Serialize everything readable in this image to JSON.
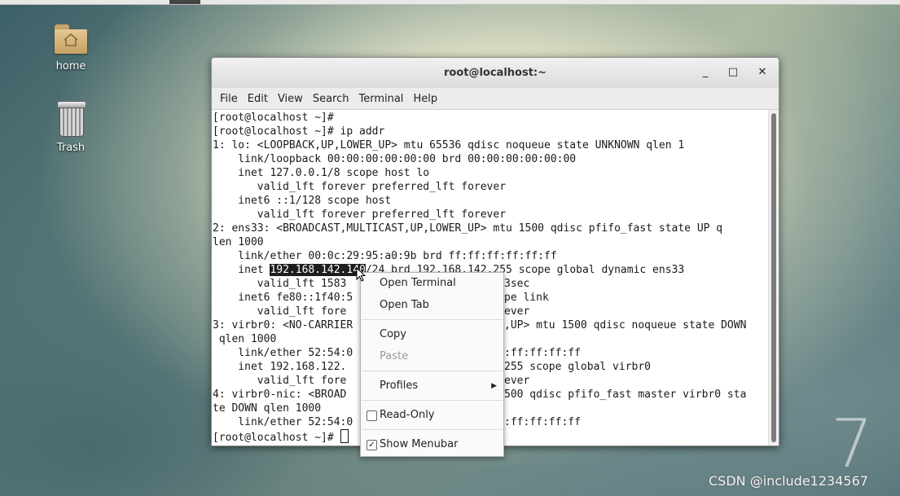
{
  "desktop": {
    "icons": [
      {
        "label": "home",
        "icon": "home-folder-icon"
      },
      {
        "label": "Trash",
        "icon": "trash-icon"
      }
    ],
    "brand_mark": "7",
    "watermark": "CSDN @include1234567"
  },
  "window": {
    "title": "root@localhost:~",
    "controls": {
      "minimize": "_",
      "maximize": "□",
      "close": "✕"
    },
    "menu": [
      "File",
      "Edit",
      "View",
      "Search",
      "Terminal",
      "Help"
    ]
  },
  "terminal": {
    "lines": [
      "[root@localhost ~]#",
      "[root@localhost ~]# ip addr",
      "1: lo: <LOOPBACK,UP,LOWER_UP> mtu 65536 qdisc noqueue state UNKNOWN qlen 1",
      "    link/loopback 00:00:00:00:00:00 brd 00:00:00:00:00:00",
      "    inet 127.0.0.1/8 scope host lo",
      "       valid_lft forever preferred_lft forever",
      "    inet6 ::1/128 scope host",
      "       valid_lft forever preferred_lft forever",
      "2: ens33: <BROADCAST,MULTICAST,UP,LOWER_UP> mtu 1500 qdisc pfifo_fast state UP q",
      "len 1000",
      "    link/ether 00:0c:29:95:a0:9b brd ff:ff:ff:ff:ff:ff",
      "    inet 192.168.142.140/24 brd 192.168.142.255 scope global dynamic ens33",
      "       valid_lft 1583",
      "    inet6 fe80::1f40:5",
      "       valid_lft fore",
      "3: virbr0: <NO-CARRIER",
      " qlen 1000",
      "    link/ether 52:54:0",
      "    inet 192.168.122.",
      "       valid_lft fore",
      "4: virbr0-nic: <BROAD",
      "te DOWN qlen 1000",
      "    link/ether 52:54:0",
      "[root@localhost ~]# "
    ],
    "right_fragments": [
      {
        "line": 12,
        "text": "3sec"
      },
      {
        "line": 13,
        "text": "pe link"
      },
      {
        "line": 14,
        "text": "ever"
      },
      {
        "line": 15,
        "text": ",UP> mtu 1500 qdisc noqueue state DOWN"
      },
      {
        "line": 17,
        "text": ":ff:ff:ff:ff"
      },
      {
        "line": 18,
        "text": "255 scope global virbr0"
      },
      {
        "line": 19,
        "text": "ever"
      },
      {
        "line": 20,
        "text": "500 qdisc pfifo_fast master virbr0 sta"
      },
      {
        "line": 22,
        "text": ":ff:ff:ff:ff"
      }
    ],
    "selection": "192.168.142.140"
  },
  "context_menu": {
    "open_terminal": "Open Terminal",
    "open_tab": "Open Tab",
    "copy": "Copy",
    "paste": "Paste",
    "profiles": "Profiles",
    "read_only": "Read-Only",
    "read_only_checked": false,
    "show_menubar": "Show Menubar",
    "show_menubar_checked": true
  }
}
